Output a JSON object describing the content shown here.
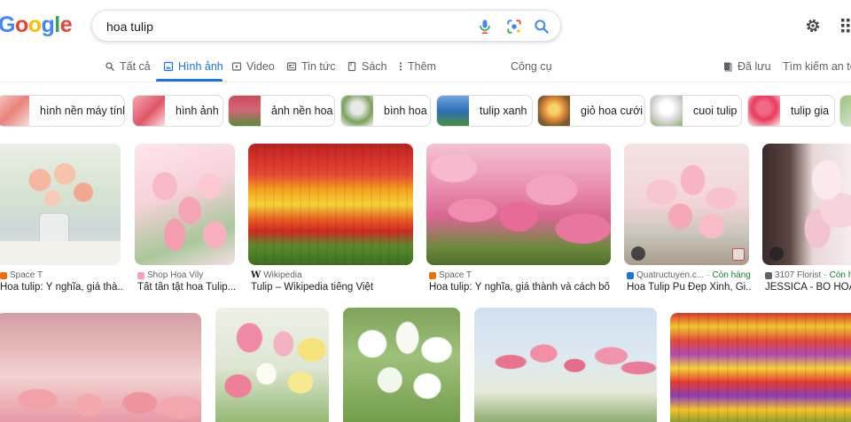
{
  "search": {
    "query": "hoa tulip"
  },
  "tabs": [
    {
      "label": "Tất cả",
      "icon": "search-icon"
    },
    {
      "label": "Hình ảnh",
      "icon": "image-icon"
    },
    {
      "label": "Video",
      "icon": "video-icon"
    },
    {
      "label": "Tin tức",
      "icon": "news-icon"
    },
    {
      "label": "Sách",
      "icon": "book-icon"
    },
    {
      "label": "Thêm",
      "icon": "more-icon"
    }
  ],
  "tools": "Công cụ",
  "saved": "Đã lưu",
  "safe_search": "Tìm kiếm an toà",
  "chips": [
    {
      "label": "hình nền máy tính"
    },
    {
      "label": "hình ảnh"
    },
    {
      "label": "ảnh nền hoa"
    },
    {
      "label": "bình hoa"
    },
    {
      "label": "tulip xanh"
    },
    {
      "label": "giỏ hoa cưới"
    },
    {
      "label": "cuoi tulip"
    },
    {
      "label": "tulip gia"
    }
  ],
  "results": [
    {
      "source": "Space T",
      "title": "Hoa tulip: Ý nghĩa, giá thà..."
    },
    {
      "source": "Shop Hoa Vily",
      "title": "Tất tần tật hoa Tulip..."
    },
    {
      "source": "Wikipedia",
      "title": "Tulip – Wikipedia tiếng Việt"
    },
    {
      "source": "Space T",
      "title": "Hoa tulip: Ý nghĩa, giá thành và cách bố..."
    },
    {
      "source": "Quatructuyen.c...",
      "status": "Còn hàng",
      "title": "Hoa Tulip Pu Đẹp Xinh, Gi..."
    },
    {
      "source": "3107 Florist",
      "status": "Còn hà",
      "title": "JESSICA - BÓ HOA T"
    }
  ],
  "colors": {
    "accent": "#1a73e8",
    "in_stock": "#188038"
  }
}
